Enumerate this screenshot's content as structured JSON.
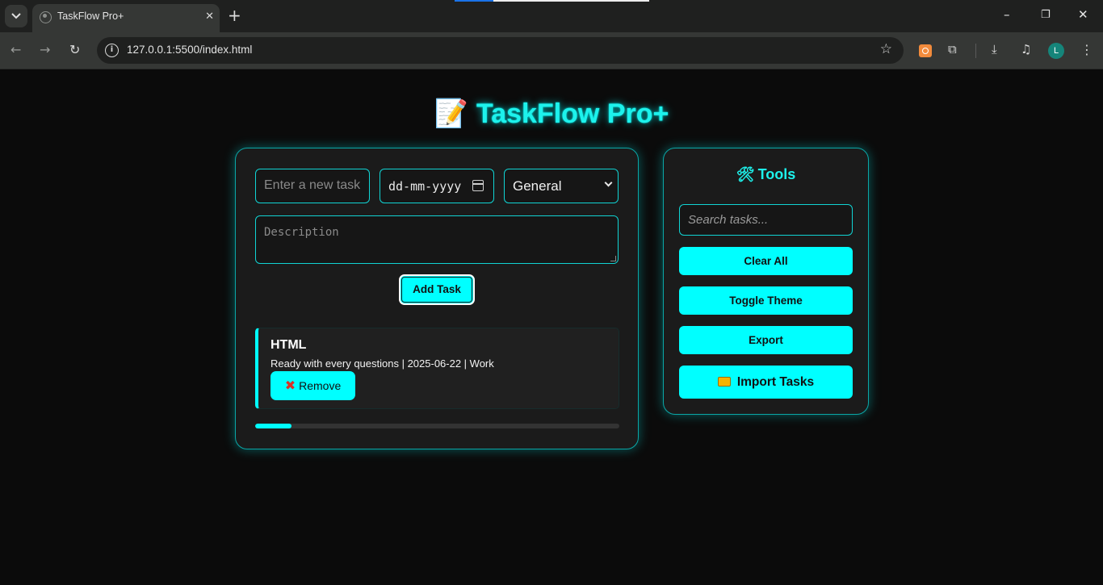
{
  "browser": {
    "tab_title": "TaskFlow Pro+",
    "url": "127.0.0.1:5500/index.html",
    "profile_initial": "L"
  },
  "app": {
    "title": "TaskFlow Pro+",
    "title_emoji": "📝",
    "accent_color": "#00ffff"
  },
  "form": {
    "task_placeholder": "Enter a new task",
    "date_placeholder": "dd-mm-yyyy",
    "category_selected": "General",
    "description_placeholder": "Description",
    "add_label": "Add Task"
  },
  "tasks": [
    {
      "title": "HTML",
      "meta": "Ready with every questions | 2025-06-22 | Work",
      "remove_label": "Remove"
    }
  ],
  "progress": {
    "fraction": 0.1
  },
  "tools": {
    "title": "Tools",
    "search_placeholder": "Search tasks...",
    "clear_label": "Clear All",
    "theme_label": "Toggle Theme",
    "export_label": "Export",
    "import_label": "Import Tasks"
  }
}
